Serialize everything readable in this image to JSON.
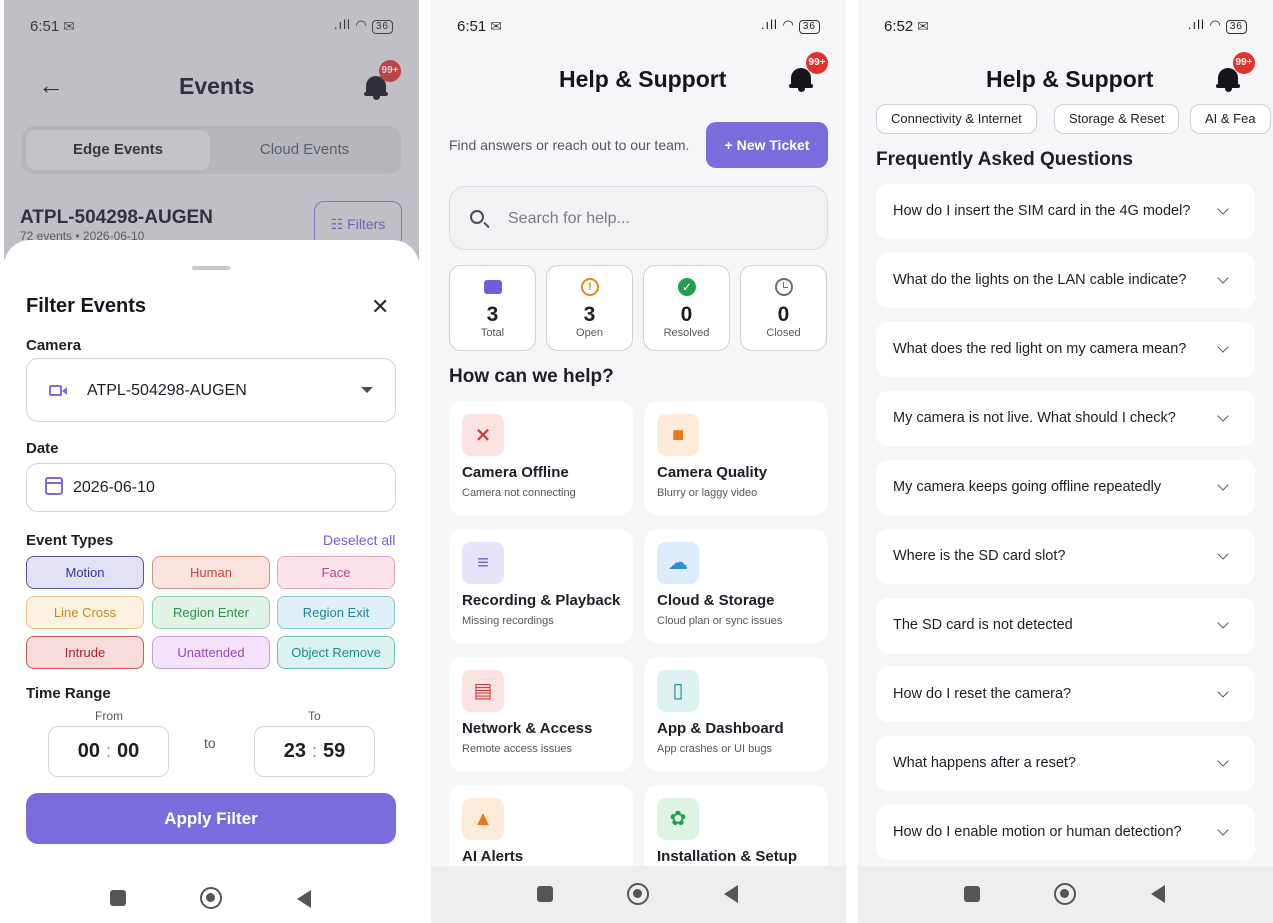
{
  "status": {
    "p1_time": "6:51",
    "p2_time": "6:51",
    "p3_time": "6:52",
    "signal": ".ıll",
    "wifi_label": "Vo WiFi",
    "battery": "36"
  },
  "events_screen": {
    "title": "Events",
    "badge": "99+",
    "tabs": [
      "Edge Events",
      "Cloud Events"
    ],
    "active_tab": "Edge Events",
    "device_name": "ATPL-504298-AUGEN",
    "device_meta": "72 events • 2026-06-10",
    "filters_label": "Filters"
  },
  "filter_sheet": {
    "title": "Filter Events",
    "camera_label": "Camera",
    "camera_value": "ATPL-504298-AUGEN",
    "date_label": "Date",
    "date_value": "2026-06-10",
    "event_types_label": "Event Types",
    "deselect_all": "Deselect all",
    "event_types": [
      {
        "label": "Motion",
        "bg": "#e3e2f5",
        "border": "#5a52a8",
        "color": "#3d3590"
      },
      {
        "label": "Human",
        "bg": "#fbe3df",
        "border": "#e08a7e",
        "color": "#c2483a"
      },
      {
        "label": "Face",
        "bg": "#fde4ec",
        "border": "#eba1ba",
        "color": "#c2477a"
      },
      {
        "label": "Line Cross",
        "bg": "#fdf1df",
        "border": "#edc587",
        "color": "#c9881c"
      },
      {
        "label": "Region Enter",
        "bg": "#e1f4e7",
        "border": "#8fd0a4",
        "color": "#2f8c4c"
      },
      {
        "label": "Region Exit",
        "bg": "#dff1f6",
        "border": "#85c8da",
        "color": "#23809a"
      },
      {
        "label": "Intrude",
        "bg": "#f8dcdc",
        "border": "#cf5757",
        "color": "#a82424"
      },
      {
        "label": "Unattended",
        "bg": "#f4e3fb",
        "border": "#c79be0",
        "color": "#9448c2"
      },
      {
        "label": "Object Remove",
        "bg": "#dcf3f1",
        "border": "#6dc2bb",
        "color": "#1f8b83"
      }
    ],
    "time_range_label": "Time Range",
    "from_label": "From",
    "to_label": "To",
    "from_hh": "00",
    "from_mm": "00",
    "to_hh": "23",
    "to_mm": "59",
    "to_word": "to",
    "apply_label": "Apply Filter"
  },
  "help_screen": {
    "title": "Help & Support",
    "badge": "99+",
    "subtitle": "Find answers or reach out to our team.",
    "new_ticket": "+ New Ticket",
    "search_placeholder": "Search for help...",
    "stats": [
      {
        "value": "3",
        "label": "Total",
        "icon": "chat-icon",
        "color": "#6f5fd9"
      },
      {
        "value": "3",
        "label": "Open",
        "icon": "alert-circle-icon",
        "color": "#e08a18"
      },
      {
        "value": "0",
        "label": "Resolved",
        "icon": "check-circle-icon",
        "color": "#22a052"
      },
      {
        "value": "0",
        "label": "Closed",
        "icon": "clock-icon",
        "color": "#6a6c74"
      }
    ],
    "help_heading": "How can we help?",
    "categories": [
      {
        "title": "Camera Offline",
        "sub": "Camera not connecting",
        "icon": "video-off-icon",
        "bg": "#fbe3e2",
        "color": "#d8383a"
      },
      {
        "title": "Camera Quality",
        "sub": "Blurry or laggy video",
        "icon": "video-icon",
        "bg": "#fdebd9",
        "color": "#e6771c"
      },
      {
        "title": "Recording & Playback",
        "sub": "Missing recordings",
        "icon": "list-icon",
        "bg": "#e6e3fb",
        "color": "#6f5fd9"
      },
      {
        "title": "Cloud & Storage",
        "sub": "Cloud plan or sync issues",
        "icon": "cloud-icon",
        "bg": "#dcecfb",
        "color": "#2d8fd8"
      },
      {
        "title": "Network & Access",
        "sub": "Remote access issues",
        "icon": "router-icon",
        "bg": "#fbe3e2",
        "color": "#d8383a"
      },
      {
        "title": "App & Dashboard",
        "sub": "App crashes or UI bugs",
        "icon": "phone-icon",
        "bg": "#dcf3f1",
        "color": "#1f8b83"
      },
      {
        "title": "AI Alerts",
        "sub": "",
        "icon": "bell-icon",
        "bg": "#fdebd9",
        "color": "#e6771c"
      },
      {
        "title": "Installation & Setup",
        "sub": "",
        "icon": "gear-icon",
        "bg": "#dff3e4",
        "color": "#22a052"
      }
    ]
  },
  "faq_screen": {
    "title": "Help & Support",
    "badge": "99+",
    "pills": [
      "Connectivity & Internet",
      "Storage & Reset",
      "AI & Fea"
    ],
    "faq_heading": "Frequently Asked Questions",
    "questions": [
      "How do I insert the SIM card in the 4G model?",
      "What do the lights on the LAN cable indicate?",
      "What does the red light on my camera mean?",
      "My camera is not live. What should I check?",
      "My camera keeps going offline repeatedly",
      "Where is the SD card slot?",
      "The SD card is not detected",
      "How do I reset the camera?",
      "What happens after a reset?",
      "How do I enable motion or human detection?"
    ]
  }
}
